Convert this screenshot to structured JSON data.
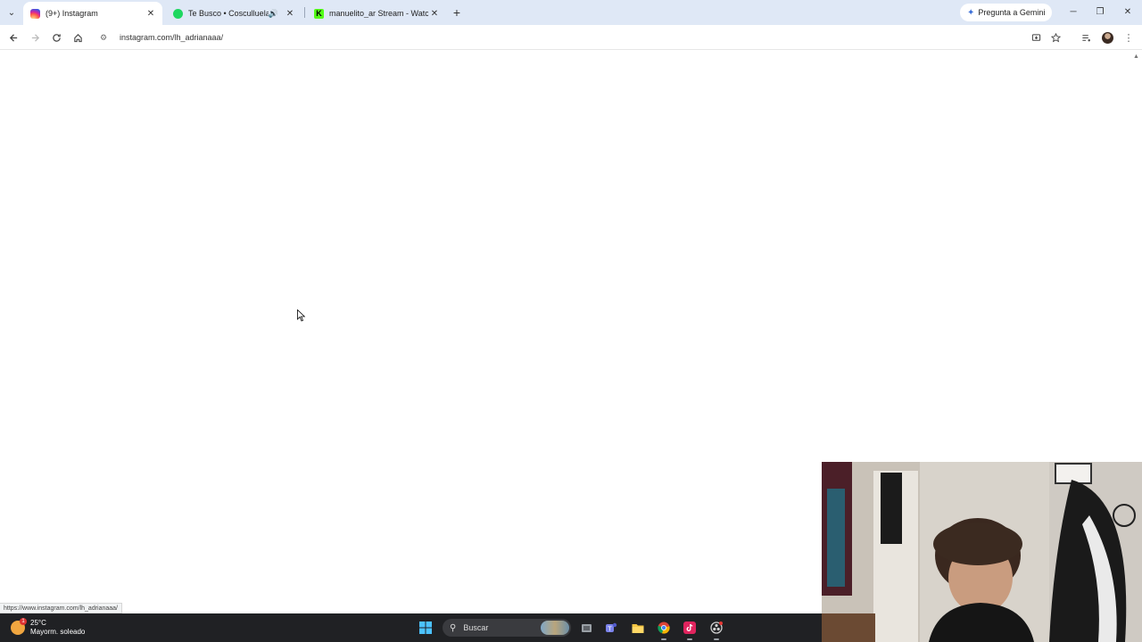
{
  "browser": {
    "tabs": [
      {
        "title": "(9+) Instagram",
        "active": true
      },
      {
        "title": "Te Busco • Cosculluela, Nick",
        "audio": true
      },
      {
        "title": "manuelito_ar Stream - Watch Li"
      }
    ],
    "gemini_label": "Pregunta a Gemini",
    "url": "instagram.com/lh_adrianaaa/",
    "status_url": "https://www.instagram.com/lh_adrianaaa/"
  },
  "taskbar": {
    "weather_temp": "25°C",
    "weather_desc": "Mayorm. soleado",
    "weather_badge": "1",
    "search_placeholder": "Buscar"
  },
  "colors": {
    "tabstrip_bg": "#dfe8f6",
    "taskbar_bg": "#202124",
    "spotify_green": "#1ed760",
    "kick_green": "#53fc18",
    "instagram_pink": "#d62976"
  },
  "icons": {
    "back": "arrow-left-icon",
    "forward": "arrow-right-icon",
    "reload": "reload-icon",
    "home": "home-icon",
    "site_info": "tune-icon",
    "install": "install-app-icon",
    "bookmark": "star-icon",
    "media": "media-controls-icon",
    "profile": "avatar",
    "menu": "kebab-menu-icon"
  }
}
